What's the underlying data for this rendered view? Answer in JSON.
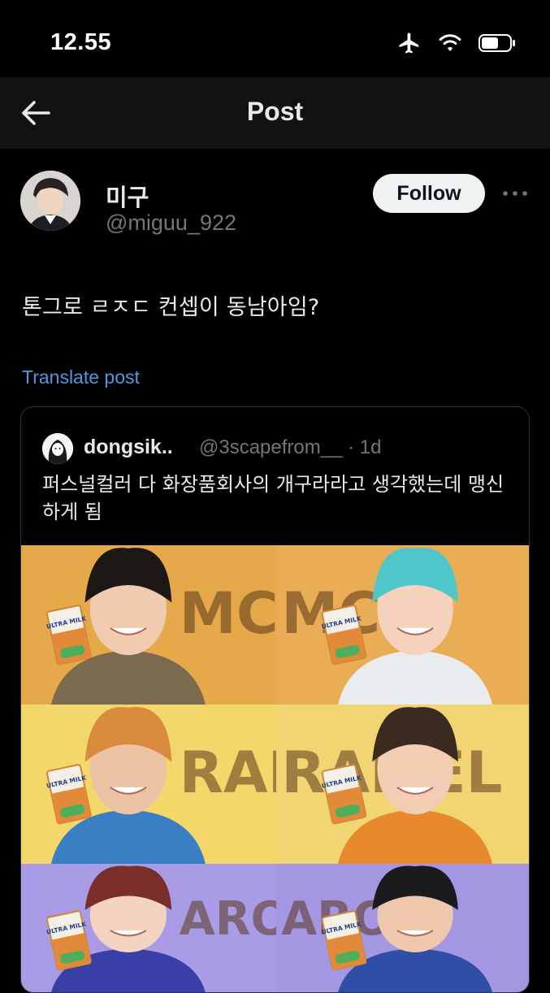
{
  "status_bar": {
    "time": "12.55"
  },
  "nav": {
    "title": "Post"
  },
  "post": {
    "author_name": "미구",
    "author_handle": "@miguu_922",
    "follow_label": "Follow",
    "text": "톤그로 ㄹㅈㄷ 컨셉이 동남아임?",
    "translate_label": "Translate post"
  },
  "quote": {
    "author_name": "dongsik..",
    "author_handle": "@3scapefrom__ · 1d",
    "text": "퍼스널컬러 다 화장품회사의 개구라라고 생각했는데 맹신하게 됨"
  },
  "media": {
    "tiles": [
      {
        "bg": "#e5a94a",
        "word": "MC"
      },
      {
        "bg": "#e8ad55",
        "word": "MC"
      },
      {
        "bg": "#f3d76a",
        "word": "RAMEL"
      },
      {
        "bg": "#f1d572",
        "word": "RAMEL"
      },
      {
        "bg": "#a99be6",
        "word": "ARO"
      },
      {
        "bg": "#a596e4",
        "word": "ARO"
      }
    ],
    "carton_label": "ULTRA MILK"
  }
}
